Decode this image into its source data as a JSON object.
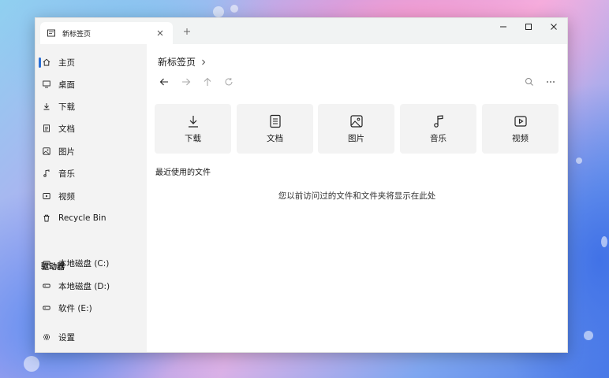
{
  "window": {
    "tab": {
      "title": "新标签页",
      "icon": "tab-page-icon"
    },
    "controls": [
      "minimize-icon",
      "maximize-icon",
      "close-icon"
    ]
  },
  "sidebar": {
    "items": [
      {
        "label": "主页",
        "icon": "home-icon"
      },
      {
        "label": "桌面",
        "icon": "desktop-icon"
      },
      {
        "label": "下载",
        "icon": "download-icon"
      },
      {
        "label": "文档",
        "icon": "document-icon"
      },
      {
        "label": "图片",
        "icon": "image-icon"
      },
      {
        "label": "音乐",
        "icon": "music-icon"
      },
      {
        "label": "视频",
        "icon": "video-icon"
      },
      {
        "label": "Recycle Bin",
        "icon": "recycle-bin-icon"
      }
    ],
    "drives_title": "驱动器",
    "drives": [
      {
        "label": "本地磁盘 (C:)",
        "icon": "drive-icon"
      },
      {
        "label": "本地磁盘 (D:)",
        "icon": "drive-icon"
      },
      {
        "label": "软件 (E:)",
        "icon": "drive-icon"
      }
    ],
    "settings_label": "设置"
  },
  "main": {
    "breadcrumb": "新标签页",
    "quick_access": [
      {
        "label": "下载",
        "icon": "download-icon"
      },
      {
        "label": "文档",
        "icon": "document-icon"
      },
      {
        "label": "图片",
        "icon": "image-icon"
      },
      {
        "label": "音乐",
        "icon": "music-icon"
      },
      {
        "label": "视频",
        "icon": "video-icon"
      }
    ],
    "recent_title": "最近使用的文件",
    "recent_empty": "您以前访问过的文件和文件夹将显示在此处"
  },
  "colors": {
    "accent": "#2a6fd6",
    "sidebar_bg": "#f3f3f3",
    "titlebar_bg": "#f1f3f3"
  }
}
